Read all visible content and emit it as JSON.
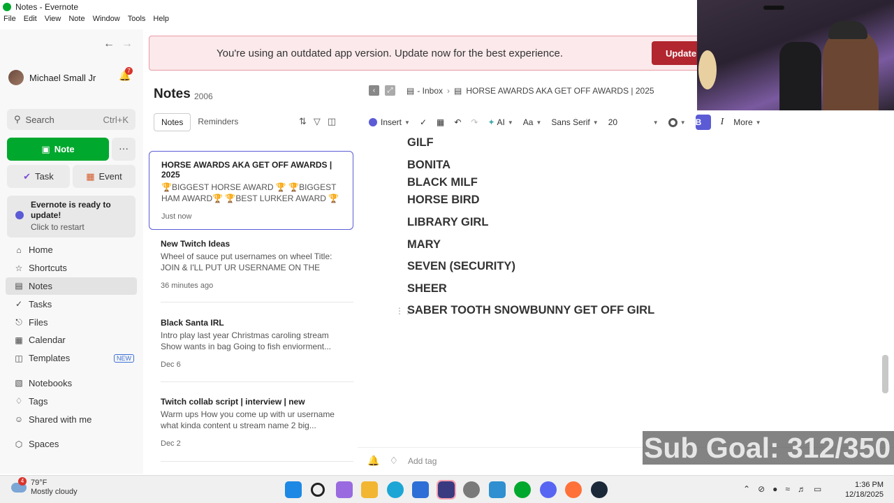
{
  "window": {
    "title": "Notes - Evernote"
  },
  "menu": [
    "File",
    "Edit",
    "View",
    "Note",
    "Window",
    "Tools",
    "Help"
  ],
  "sidebar": {
    "user_name": "Michael Small Jr",
    "notification_count": "7",
    "search_label": "Search",
    "search_shortcut": "Ctrl+K",
    "note_button": "Note",
    "more_button": "···",
    "task_button": "Task",
    "event_button": "Event",
    "update_title": "Evernote is ready to update!",
    "update_subtitle": "Click to restart",
    "nav": [
      {
        "label": "Home",
        "icon": "home-icon"
      },
      {
        "label": "Shortcuts",
        "icon": "star-icon"
      },
      {
        "label": "Notes",
        "icon": "notes-icon"
      },
      {
        "label": "Tasks",
        "icon": "check-circle-icon"
      },
      {
        "label": "Files",
        "icon": "paperclip-icon"
      },
      {
        "label": "Calendar",
        "icon": "calendar-icon"
      },
      {
        "label": "Templates",
        "icon": "template-icon",
        "badge": "NEW"
      },
      {
        "label": "Notebooks",
        "icon": "notebook-icon"
      },
      {
        "label": "Tags",
        "icon": "tag-icon"
      },
      {
        "label": "Shared with me",
        "icon": "users-icon"
      },
      {
        "label": "Spaces",
        "icon": "cube-icon"
      }
    ]
  },
  "banner": {
    "message": "You're using an outdated app version. Update now for the best experience.",
    "button": "Update"
  },
  "notes_list": {
    "title": "Notes",
    "count": "2006",
    "tabs": [
      "Notes",
      "Reminders"
    ],
    "notes": [
      {
        "title": "HORSE AWARDS AKA GET OFF AWARDS | 2025",
        "preview": "🏆BIGGEST HORSE AWARD 🏆 🏆BIGGEST HAM AWARD🏆 🏆BEST LURKER AWARD 🏆 🏆...",
        "date": "Just now"
      },
      {
        "title": "New Twitch Ideas",
        "preview": "Wheel of sauce put usernames on wheel Title: JOIN & I'LL PUT UR USERNAME ON THE WHEEL...",
        "date": "36 minutes ago"
      },
      {
        "title": "Black Santa IRL",
        "preview": "Intro play last year Christmas caroling stream Show wants in bag Going to fish enviorment...",
        "date": "Dec 6"
      },
      {
        "title": "Twitch collab script | interview | new",
        "preview": "Warm ups How you come up with ur username what kinda content u stream name 2 big...",
        "date": "Dec 2"
      }
    ]
  },
  "editor": {
    "breadcrumb_notebook": "- Inbox",
    "breadcrumb_note": "HORSE AWARDS AKA GET OFF AWARDS | 2025",
    "toolbar": {
      "insert": "Insert",
      "ai": "AI",
      "text_style": "Aa",
      "font": "Sans Serif",
      "size": "20",
      "bold": "B",
      "italic": "I",
      "more": "More"
    },
    "lines": [
      "GILF",
      "BONITA",
      "BLACK MILF",
      "HORSE BIRD",
      "LIBRARY GIRL",
      "MARY",
      "SEVEN (SECURITY)",
      "SHEER",
      "SABER TOOTH SNOWBUNNY GET OFF GIRL"
    ],
    "add_tag": "Add tag"
  },
  "overlay": {
    "sub_goal": "Sub Goal: 312/350"
  },
  "taskbar": {
    "weather_badge": "4",
    "temperature": "79°F",
    "conditions": "Mostly cloudy",
    "time": "1:36 PM",
    "date": "12/18/2025",
    "apps": [
      {
        "icon": "windows-start-icon",
        "color": "#1e88e5"
      },
      {
        "icon": "search-icon",
        "color": "#f0f0f0"
      },
      {
        "icon": "copilot-icon",
        "color": "#9a6ae0"
      },
      {
        "icon": "file-explorer-icon",
        "color": "#f2b632"
      },
      {
        "icon": "edge-icon",
        "color": "#1ba6d6"
      },
      {
        "icon": "store-icon",
        "color": "#2d6fd6"
      },
      {
        "icon": "obs-icon",
        "color": "#3a3a80"
      },
      {
        "icon": "settings-icon",
        "color": "#7a7a7a"
      },
      {
        "icon": "photos-icon",
        "color": "#2f8fd0"
      },
      {
        "icon": "evernote-icon",
        "color": "#00a82d"
      },
      {
        "icon": "discord-icon",
        "color": "#5865f2"
      },
      {
        "icon": "firefox-icon",
        "color": "#ff7139"
      },
      {
        "icon": "steam-icon",
        "color": "#1b2838"
      }
    ]
  }
}
